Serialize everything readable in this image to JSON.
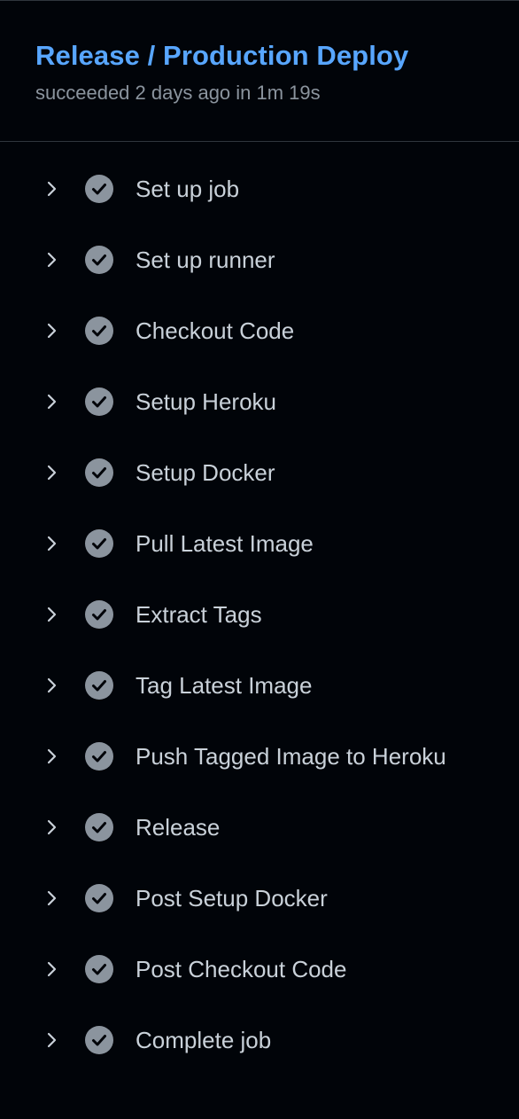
{
  "header": {
    "title": "Release / Production Deploy",
    "subtitle": "succeeded 2 days ago in 1m 19s"
  },
  "colors": {
    "background": "#010409",
    "title": "#58a6ff",
    "subtitle": "#8b949e",
    "step_text": "#c9d1d9",
    "check_bg": "#8b949e",
    "divider": "#30363d"
  },
  "steps": [
    {
      "label": "Set up job",
      "status": "success",
      "icon": "check-circle-icon"
    },
    {
      "label": "Set up runner",
      "status": "success",
      "icon": "check-circle-icon"
    },
    {
      "label": "Checkout Code",
      "status": "success",
      "icon": "check-circle-icon"
    },
    {
      "label": "Setup Heroku",
      "status": "success",
      "icon": "check-circle-icon"
    },
    {
      "label": "Setup Docker",
      "status": "success",
      "icon": "check-circle-icon"
    },
    {
      "label": "Pull Latest Image",
      "status": "success",
      "icon": "check-circle-icon"
    },
    {
      "label": "Extract Tags",
      "status": "success",
      "icon": "check-circle-icon"
    },
    {
      "label": "Tag Latest Image",
      "status": "success",
      "icon": "check-circle-icon"
    },
    {
      "label": "Push Tagged Image to Heroku",
      "status": "success",
      "icon": "check-circle-icon"
    },
    {
      "label": "Release",
      "status": "success",
      "icon": "check-circle-icon"
    },
    {
      "label": "Post Setup Docker",
      "status": "success",
      "icon": "check-circle-icon"
    },
    {
      "label": "Post Checkout Code",
      "status": "success",
      "icon": "check-circle-icon"
    },
    {
      "label": "Complete job",
      "status": "success",
      "icon": "check-circle-icon"
    }
  ]
}
